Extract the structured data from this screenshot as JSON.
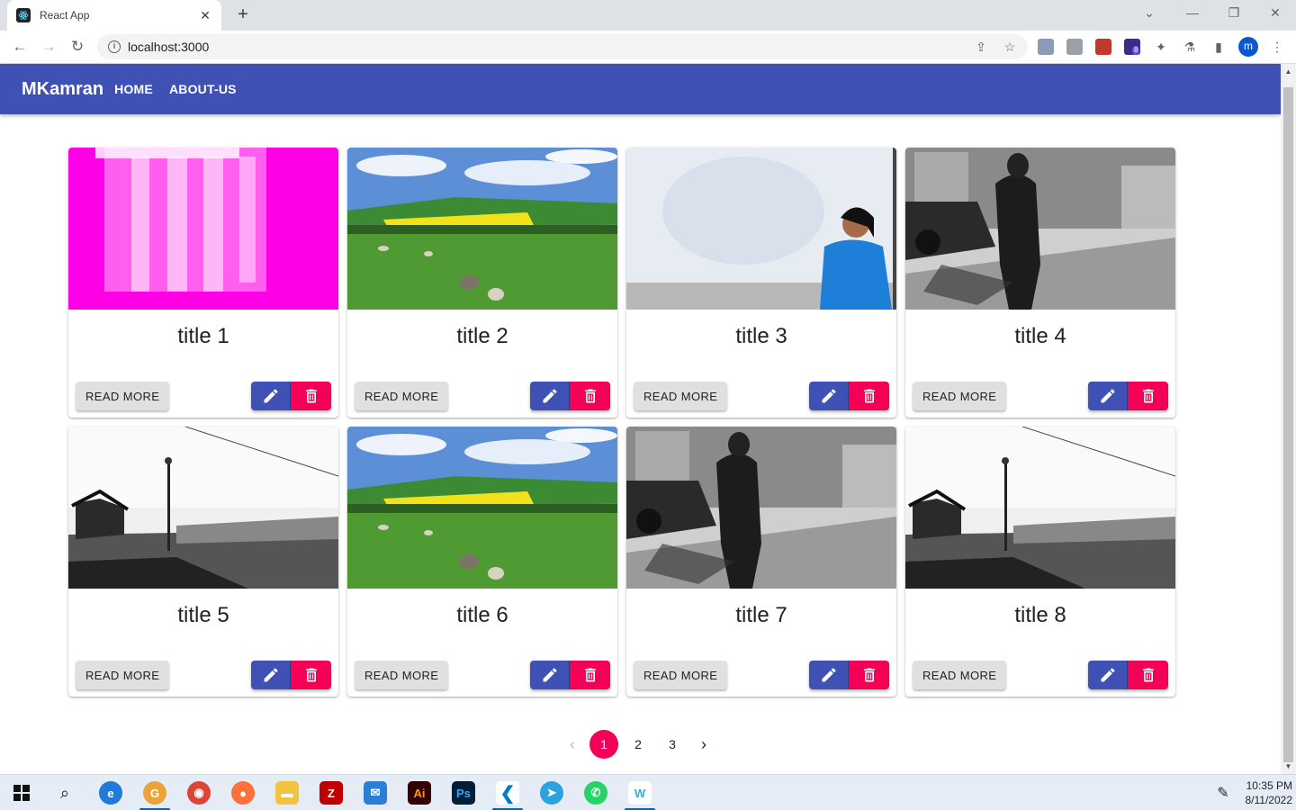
{
  "browser": {
    "tab_title": "React App",
    "url": "localhost:3000",
    "profile_initial": "m",
    "extension_badge": "8"
  },
  "appbar": {
    "brand": "MKamran",
    "nav": [
      "HOME",
      "ABOUT-US"
    ],
    "color": "#3f51b5"
  },
  "cards": [
    {
      "title": "title 1",
      "read_more": "READ MORE",
      "image": "pink-abstract-light"
    },
    {
      "title": "title 2",
      "read_more": "READ MORE",
      "image": "green-field-with-sheep"
    },
    {
      "title": "title 3",
      "read_more": "READ MORE",
      "image": "woman-presenting-blue"
    },
    {
      "title": "title 4",
      "read_more": "READ MORE",
      "image": "bw-street-woman-walking"
    },
    {
      "title": "title 5",
      "read_more": "READ MORE",
      "image": "bw-landscape-lamppost"
    },
    {
      "title": "title 6",
      "read_more": "READ MORE",
      "image": "green-field-with-sheep"
    },
    {
      "title": "title 7",
      "read_more": "READ MORE",
      "image": "bw-street-woman-walking"
    },
    {
      "title": "title 8",
      "read_more": "READ MORE",
      "image": "bw-landscape-lamppost"
    }
  ],
  "pagination": {
    "pages": [
      "1",
      "2",
      "3"
    ],
    "current": "1",
    "accent": "#f50057"
  },
  "taskbar": {
    "time": "10:35 PM",
    "date": "8/11/2022"
  }
}
